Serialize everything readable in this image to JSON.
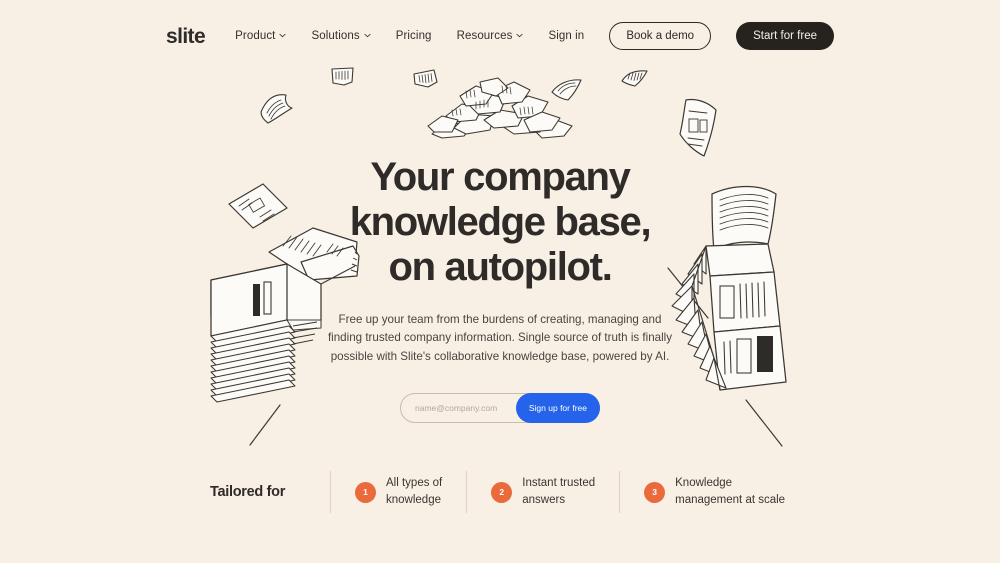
{
  "brand": {
    "logo": "slite",
    "accent_blue": "#2563EB",
    "accent_orange": "#EA6A3C",
    "background": "#F8EFE5",
    "ink": "#2E2B28"
  },
  "header": {
    "nav": [
      {
        "label": "Product",
        "has_caret": true
      },
      {
        "label": "Solutions",
        "has_caret": true
      },
      {
        "label": "Pricing",
        "has_caret": false
      },
      {
        "label": "Resources",
        "has_caret": true
      },
      {
        "label": "Sign in",
        "has_caret": false
      }
    ],
    "demo_button": "Book a demo",
    "cta_button": "Start for free"
  },
  "hero": {
    "headline_line1": "Your company",
    "headline_line2": "knowledge base,",
    "headline_line3": "on autopilot.",
    "subhead": "Free up your team from the burdens of creating, managing and finding trusted company information. Single source of truth is finally possible with Slite's collaborative knowledge base, powered by AI.",
    "email_placeholder": "name@company.com",
    "email_value": "",
    "signup_button": "Sign up for free"
  },
  "tailored": {
    "label": "Tailored for",
    "features": [
      {
        "number": "1",
        "text": "All types of\nknowledge"
      },
      {
        "number": "2",
        "text": "Instant trusted\nanswers"
      },
      {
        "number": "3",
        "text": "Knowledge\nmanagement at scale"
      }
    ]
  }
}
